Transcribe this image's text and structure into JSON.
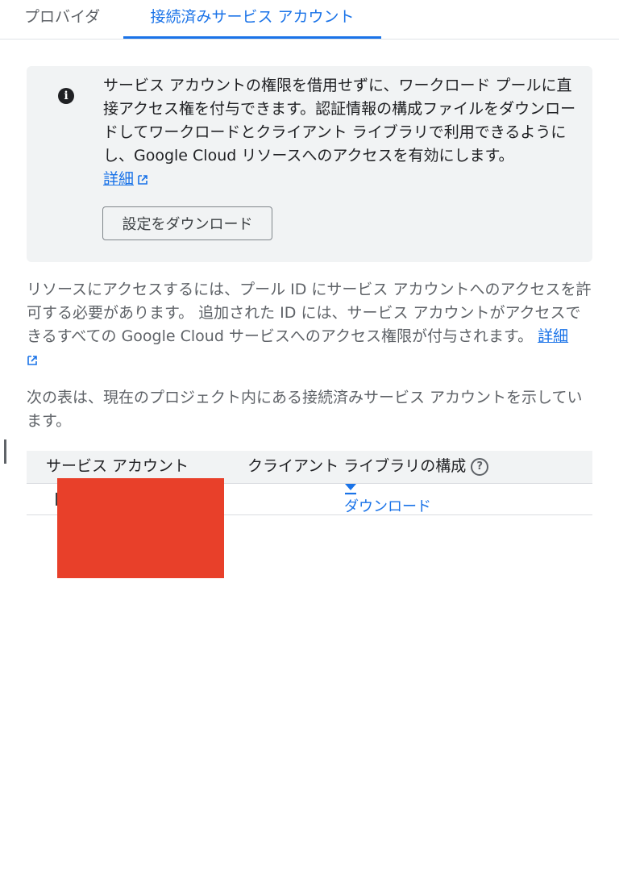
{
  "tabs": {
    "providers": "プロバイダ",
    "connected_accounts": "接続済みサービス アカウント"
  },
  "info_box": {
    "text": "サービス アカウントの権限を借用せずに、ワークロード プールに直接アクセス権を付与できます。認証情報の構成ファイルをダウンロードしてワークロードとクライアント ライブラリで利用できるようにし、Google Cloud リソースへのアクセスを有効にします。",
    "details_link": "詳細",
    "download_button": "設定をダウンロード",
    "icon": "info-icon"
  },
  "para1": {
    "text": "リソースにアクセスするには、プール ID にサービス アカウントへのアクセスを許可する必要があります。 追加された ID には、サービス アカウントがアクセスできるすべての Google Cloud サービスへのアクセス権限が付与されます。 ",
    "details_link": "詳細"
  },
  "para2": {
    "text": "次の表は、現在のプロジェクト内にある接続済みサービス アカウントを示しています。"
  },
  "table": {
    "headers": {
      "service_account": "サービス アカウント",
      "client_library_config": "クライアント ライブラリの構成"
    },
    "rows": [
      {
        "download_label": "ダウンロード"
      }
    ]
  },
  "colors": {
    "accent": "#1a73e8",
    "redaction": "#e8402a",
    "info_bg": "#f1f3f4"
  }
}
